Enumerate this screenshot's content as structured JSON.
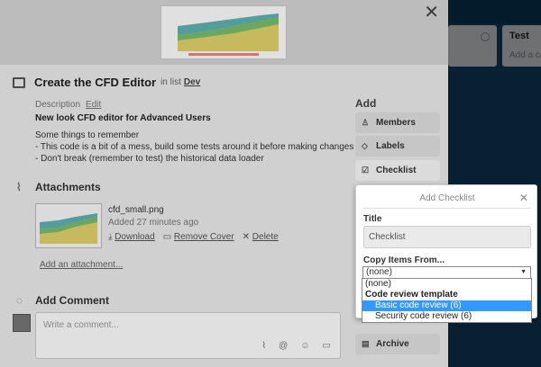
{
  "background": {
    "lists": [
      {
        "title": "",
        "add_text": ""
      },
      {
        "title": "Test",
        "add_text": "Add a ca"
      }
    ],
    "left_fragment": "s"
  },
  "card": {
    "title": "Create the CFD Editor",
    "in_list_prefix": "in list",
    "list_name": "Dev",
    "description_label": "Description",
    "edit_label": "Edit",
    "description_heading": "New look CFD editor for Advanced Users",
    "description_lines": [
      "Some things to remember",
      "- This code is a bit of a mess, build some tests around it before making changes",
      "- Don't break (remember to test) the historical data loader"
    ],
    "attachments_heading": "Attachments",
    "attachment": {
      "filename": "cfd_small.png",
      "added": "Added 27 minutes ago",
      "download": "Download",
      "remove_cover": "Remove Cover",
      "delete": "Delete"
    },
    "add_attachment": "Add an attachment...",
    "add_comment_heading": "Add Comment",
    "comment_placeholder": "Write a comment...",
    "comment_icons": [
      "paperclip-icon",
      "at-icon",
      "smiley-icon",
      "card-icon"
    ]
  },
  "sidebar": {
    "add_heading": "Add",
    "buttons": [
      {
        "label": "Members",
        "icon": "person-icon"
      },
      {
        "label": "Labels",
        "icon": "tag-icon"
      },
      {
        "label": "Checklist",
        "icon": "checkbox-icon"
      },
      {
        "label": "Archive",
        "icon": "archive-icon"
      }
    ]
  },
  "popover": {
    "title": "Add Checklist",
    "title_label": "Title",
    "title_value": "Checklist",
    "copy_label": "Copy Items From...",
    "select_value": "(none)",
    "options": [
      {
        "label": "(none)",
        "kind": "option"
      },
      {
        "label": "Code review template",
        "kind": "group"
      },
      {
        "label": "Basic code review (6)",
        "kind": "option",
        "selected": true
      },
      {
        "label": "Security code review (6)",
        "kind": "option"
      }
    ]
  },
  "colors": {
    "board_bg": "#0d3b5c",
    "selected_option": "#3399ff",
    "chart_teal": "#5fb3b3",
    "chart_yellow": "#e2d36b",
    "chart_green": "#7bbf6a"
  }
}
